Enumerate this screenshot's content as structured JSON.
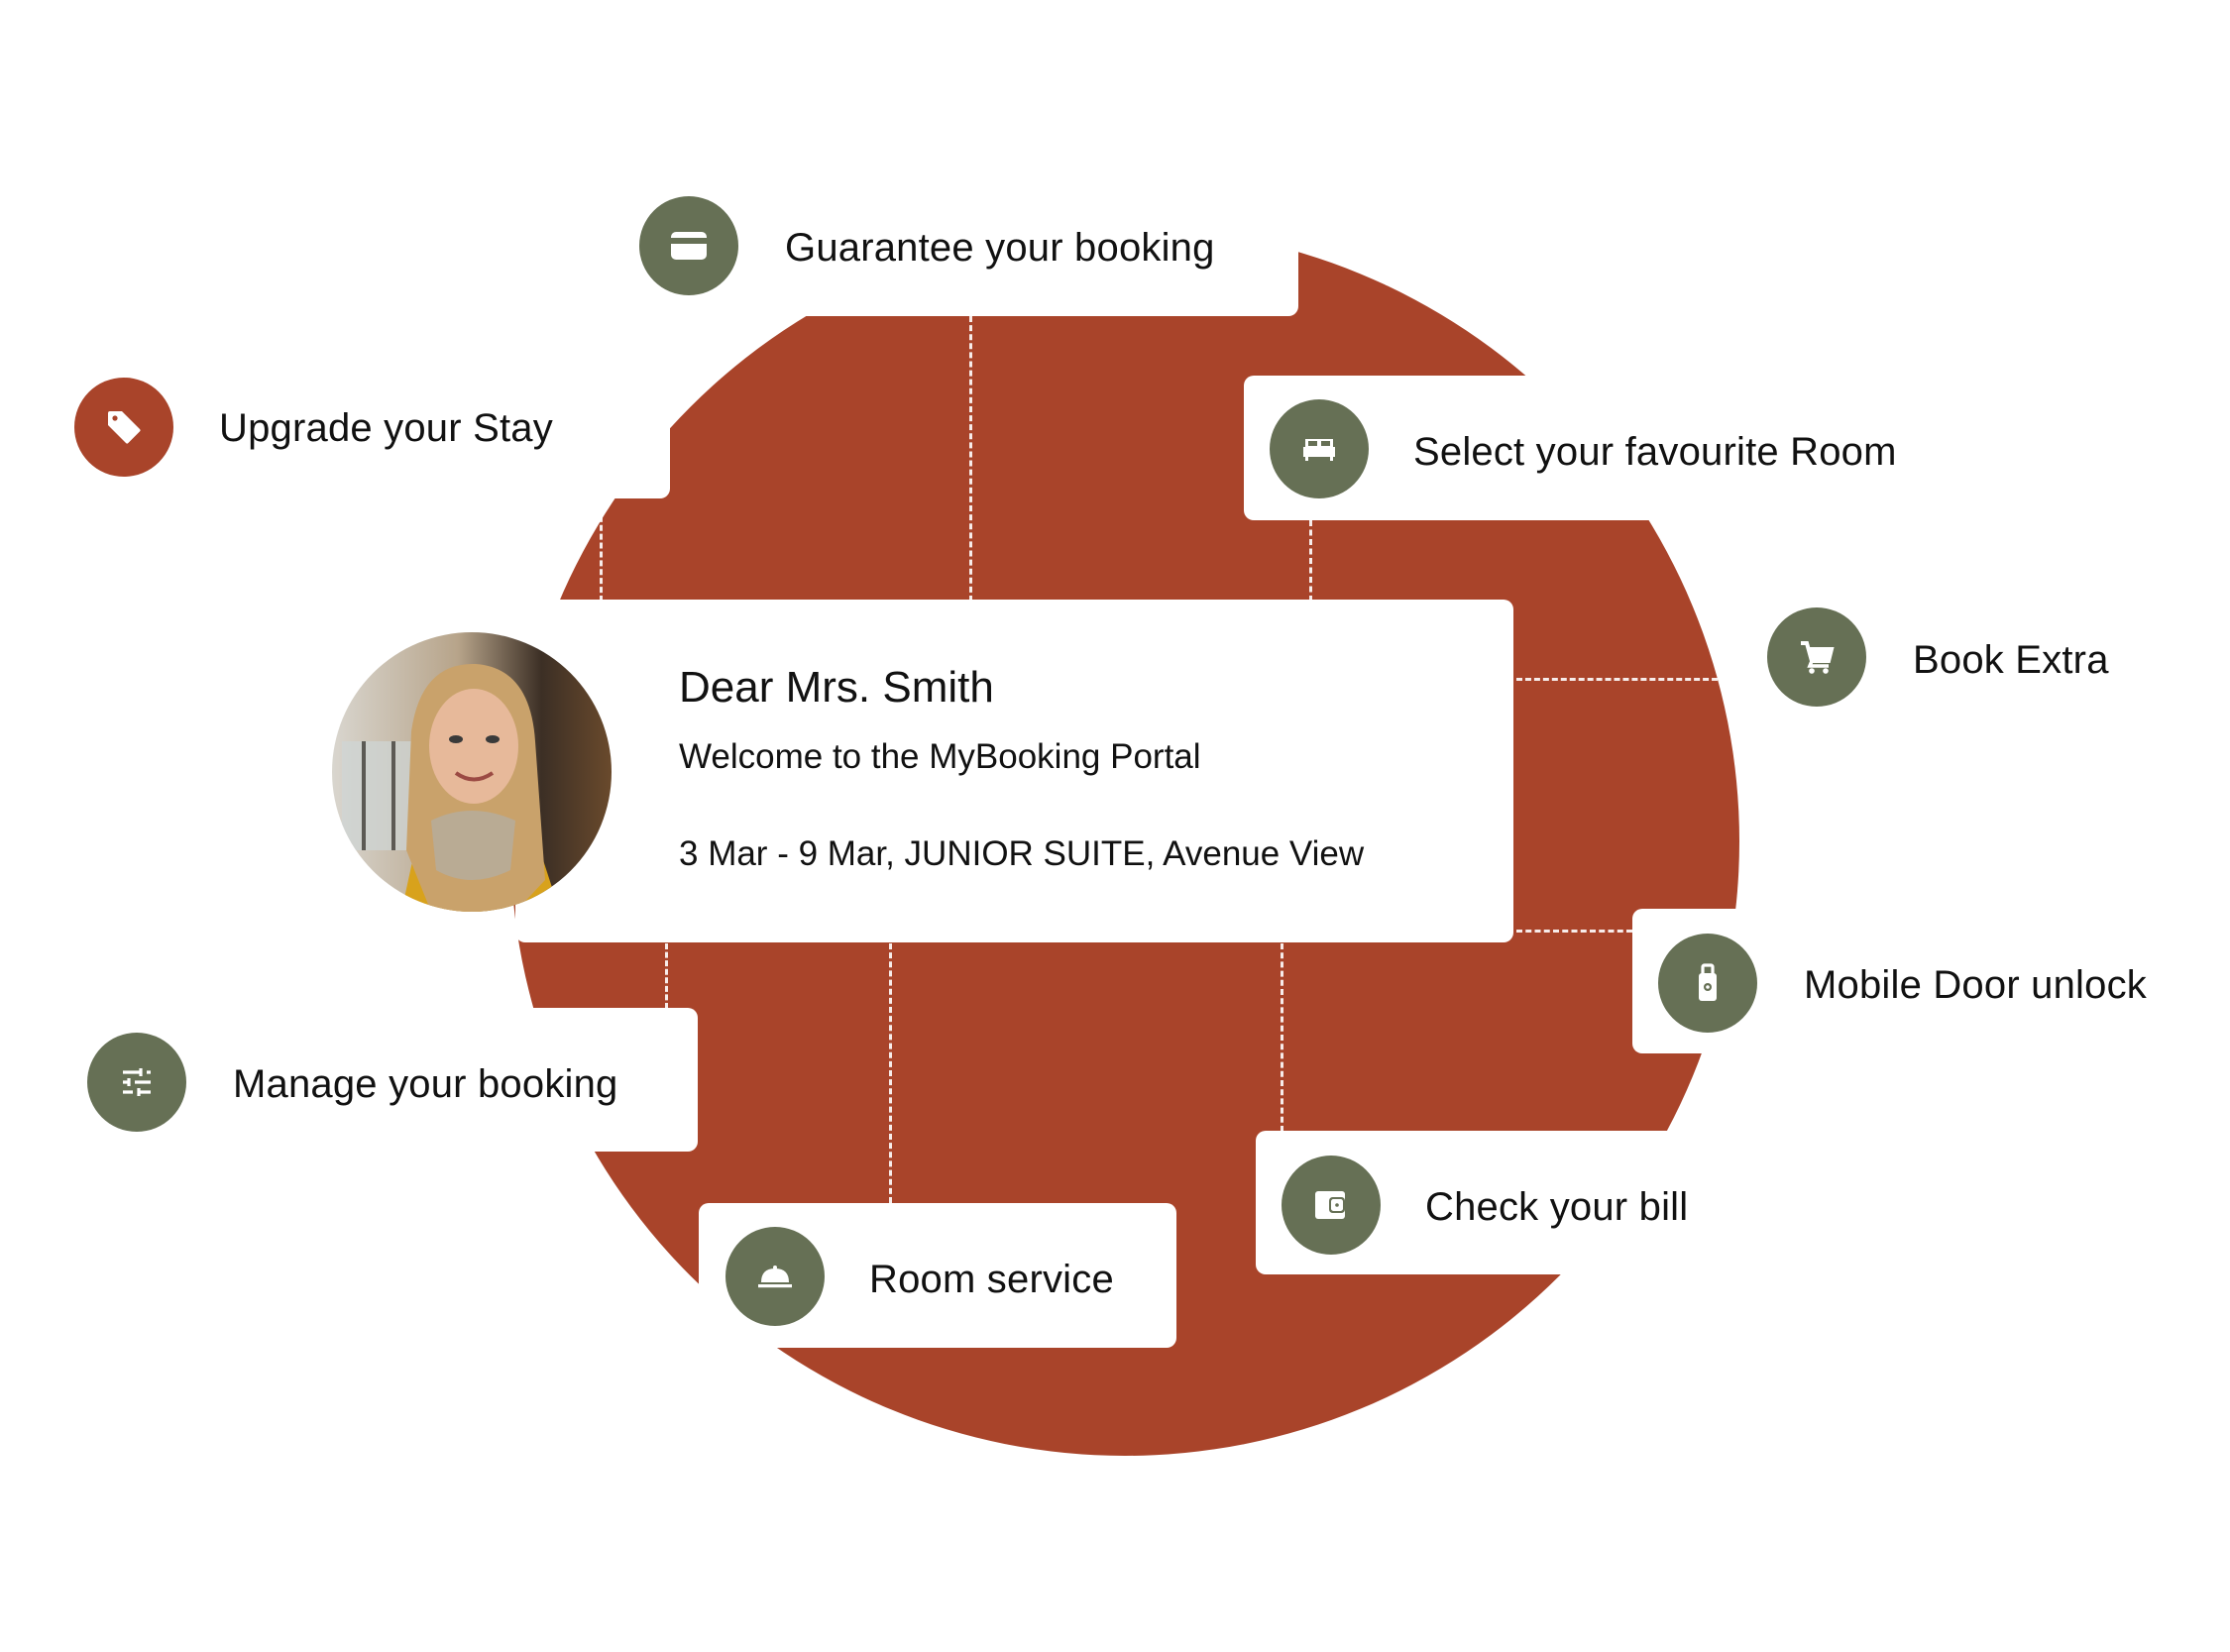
{
  "colors": {
    "blob": "#A9442A",
    "icon_green": "#667055",
    "icon_red": "#A9442A",
    "card": "#FFFFFF",
    "text": "#111111"
  },
  "welcome": {
    "greeting": "Dear Mrs. Smith",
    "subtitle": "Welcome to the MyBooking Portal",
    "booking_details": "3 Mar - 9 Mar, JUNIOR SUITE, Avenue View",
    "avatar_alt": "Guest photo"
  },
  "features": [
    {
      "id": "guarantee",
      "label": "Guarantee your booking",
      "icon": "credit-card-icon"
    },
    {
      "id": "upgrade",
      "label": "Upgrade your Stay",
      "icon": "tag-icon"
    },
    {
      "id": "select-room",
      "label": "Select your favourite Room",
      "icon": "bed-icon"
    },
    {
      "id": "book-extra",
      "label": "Book Extra",
      "icon": "shopping-cart-icon"
    },
    {
      "id": "mobile-door",
      "label": "Mobile Door unlock",
      "icon": "door-key-icon"
    },
    {
      "id": "manage",
      "label": "Manage your booking",
      "icon": "sliders-icon"
    },
    {
      "id": "room-service",
      "label": "Room service",
      "icon": "cloche-icon"
    },
    {
      "id": "check-bill",
      "label": "Check your bill",
      "icon": "wallet-icon"
    }
  ]
}
